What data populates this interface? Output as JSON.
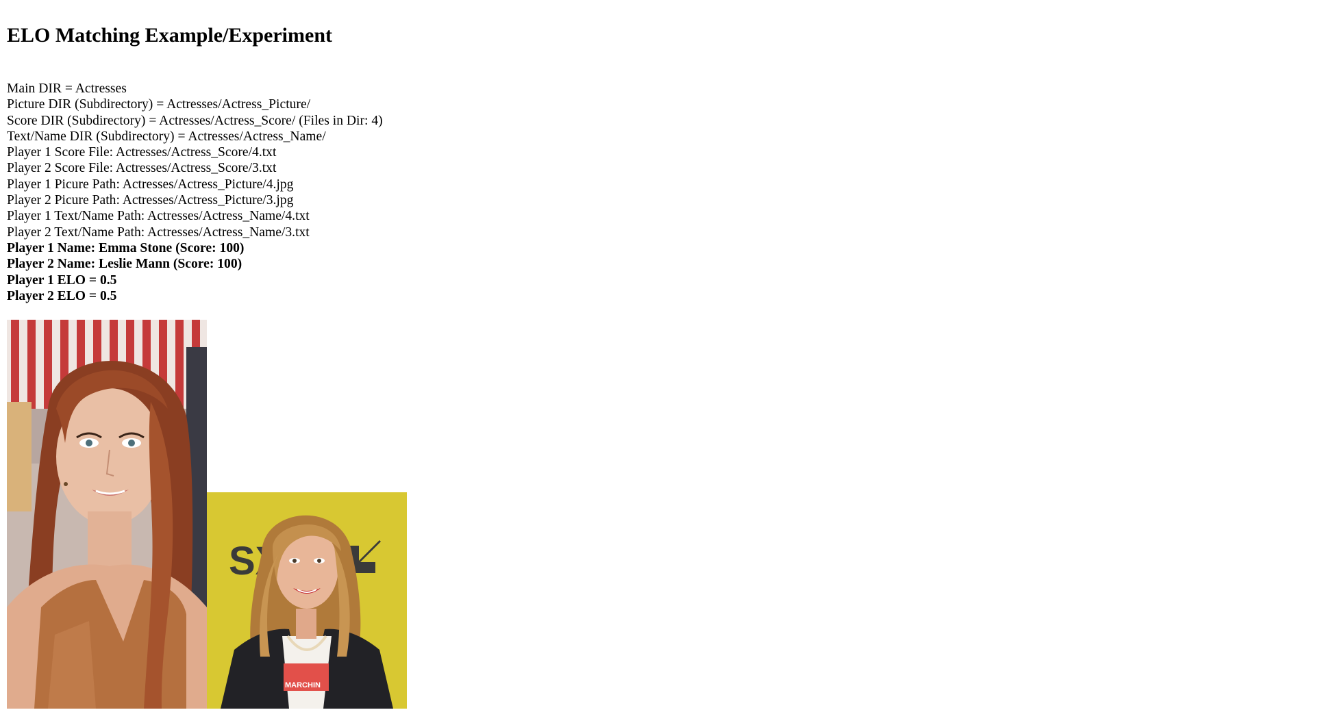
{
  "page": {
    "title": "ELO Matching Example/Experiment"
  },
  "info": {
    "main_dir": "Main DIR = Actresses",
    "picture_dir": "Picture DIR (Subdirectory) = Actresses/Actress_Picture/",
    "score_dir": "Score DIR (Subdirectory) = Actresses/Actress_Score/ (Files in Dir: 4)",
    "name_dir": "Text/Name DIR (Subdirectory) = Actresses/Actress_Name/",
    "p1_score_file": "Player 1 Score File: Actresses/Actress_Score/4.txt",
    "p2_score_file": "Player 2 Score File: Actresses/Actress_Score/3.txt",
    "p1_picture_path": "Player 1 Picure Path: Actresses/Actress_Picture/4.jpg",
    "p2_picture_path": "Player 2 Picure Path: Actresses/Actress_Picture/3.jpg",
    "p1_name_path": "Player 1 Text/Name Path: Actresses/Actress_Name/4.txt",
    "p2_name_path": "Player 2 Text/Name Path: Actresses/Actress_Name/3.txt",
    "p1_name": "Player 1 Name: Emma Stone (Score: 100)",
    "p2_name": "Player 2 Name: Leslie Mann (Score: 100)",
    "p1_elo": "Player 1 ELO = 0.5",
    "p2_elo": "Player 2 ELO = 0.5"
  },
  "photos": {
    "player1_sign_text": "",
    "player2_backdrop_text": "SX",
    "player2_shirt_text": "MARCHIN"
  },
  "colors": {
    "page_background": "#ffffff",
    "text": "#000000",
    "photo2_backdrop": "#d8c832"
  }
}
